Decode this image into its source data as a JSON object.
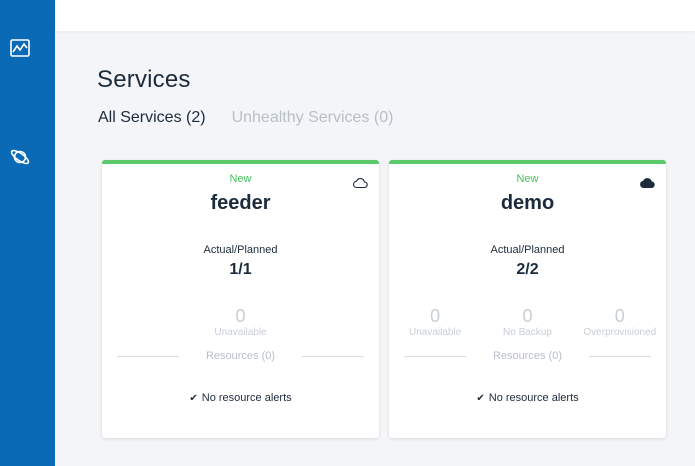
{
  "sidebar": {
    "items": [
      {
        "icon": "chart-icon"
      },
      {
        "icon": "planet-icon"
      }
    ]
  },
  "page": {
    "title": "Services"
  },
  "tabs": [
    {
      "label": "All Services (2)",
      "active": true
    },
    {
      "label": "Unhealthy Services (0)",
      "active": false
    }
  ],
  "services": [
    {
      "status": "New",
      "name": "feeder",
      "cloud_icon": "cloud-outline-icon",
      "actual_planned_label": "Actual/Planned",
      "actual_planned": "1/1",
      "metrics": [
        {
          "value": "0",
          "label": "Unavailable"
        }
      ],
      "resources": "Resources (0)",
      "alerts": "No resource alerts"
    },
    {
      "status": "New",
      "name": "demo",
      "cloud_icon": "cloud-filled-icon",
      "actual_planned_label": "Actual/Planned",
      "actual_planned": "2/2",
      "metrics": [
        {
          "value": "0",
          "label": "Unavailable"
        },
        {
          "value": "0",
          "label": "No Backup"
        },
        {
          "value": "0",
          "label": "Overprovisioned"
        }
      ],
      "resources": "Resources (0)",
      "alerts": "No resource alerts"
    }
  ],
  "colors": {
    "sidebar": "#0a6ab6",
    "healthy": "#5cca6a",
    "status_text": "#47c25e"
  }
}
